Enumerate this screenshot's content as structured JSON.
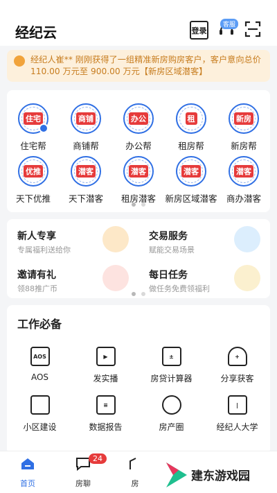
{
  "header": {
    "title": "经纪云",
    "login_icon_text": "登录",
    "service_badge": "客服"
  },
  "notice": {
    "text": "经纪人崔** 刚刚获得了一组精准新房购房客户，客户意向总价 110.00 万元至 900.00 万元【新房区域潜客】"
  },
  "quick_apps": {
    "row1": [
      {
        "badge": "住宅",
        "label": "住宅帮"
      },
      {
        "badge": "商铺",
        "label": "商铺帮"
      },
      {
        "badge": "办公",
        "label": "办公帮"
      },
      {
        "badge": "租",
        "label": "租房帮"
      },
      {
        "badge": "新房",
        "label": "新房帮"
      }
    ],
    "row2": [
      {
        "badge": "优推",
        "label": "天下优推"
      },
      {
        "badge": "潜客",
        "label": "天下潜客"
      },
      {
        "badge": "潜客",
        "label": "租房潜客"
      },
      {
        "badge": "潜客",
        "label": "新房区域潜客"
      },
      {
        "badge": "潜客",
        "label": "商办潜客"
      }
    ]
  },
  "services": [
    {
      "title": "新人专享",
      "subtitle": "专属福利送给你"
    },
    {
      "title": "交易服务",
      "subtitle": "赋能交易场景"
    },
    {
      "title": "邀请有礼",
      "subtitle": "领88推广币"
    },
    {
      "title": "每日任务",
      "subtitle": "做任务免费领福利"
    }
  ],
  "tools": {
    "title": "工作必备",
    "row1": [
      {
        "label": "AOS",
        "icon_text": "AOS"
      },
      {
        "label": "发实播"
      },
      {
        "label": "房贷计算器"
      },
      {
        "label": "分享获客"
      }
    ],
    "row2": [
      {
        "label": "小区建设"
      },
      {
        "label": "数据报告"
      },
      {
        "label": "房产圈"
      },
      {
        "label": "经纪人大学"
      }
    ]
  },
  "tabbar": {
    "home": "首页",
    "chat": "房聊",
    "chat_badge": "24",
    "third_partial": "房"
  },
  "watermark": {
    "text": "建东游戏园"
  },
  "colors": {
    "accent": "#2f6fe4",
    "notice_bg": "#fdf0dc",
    "notice_text": "#c77c1e",
    "badge_red": "#e63b3b"
  }
}
